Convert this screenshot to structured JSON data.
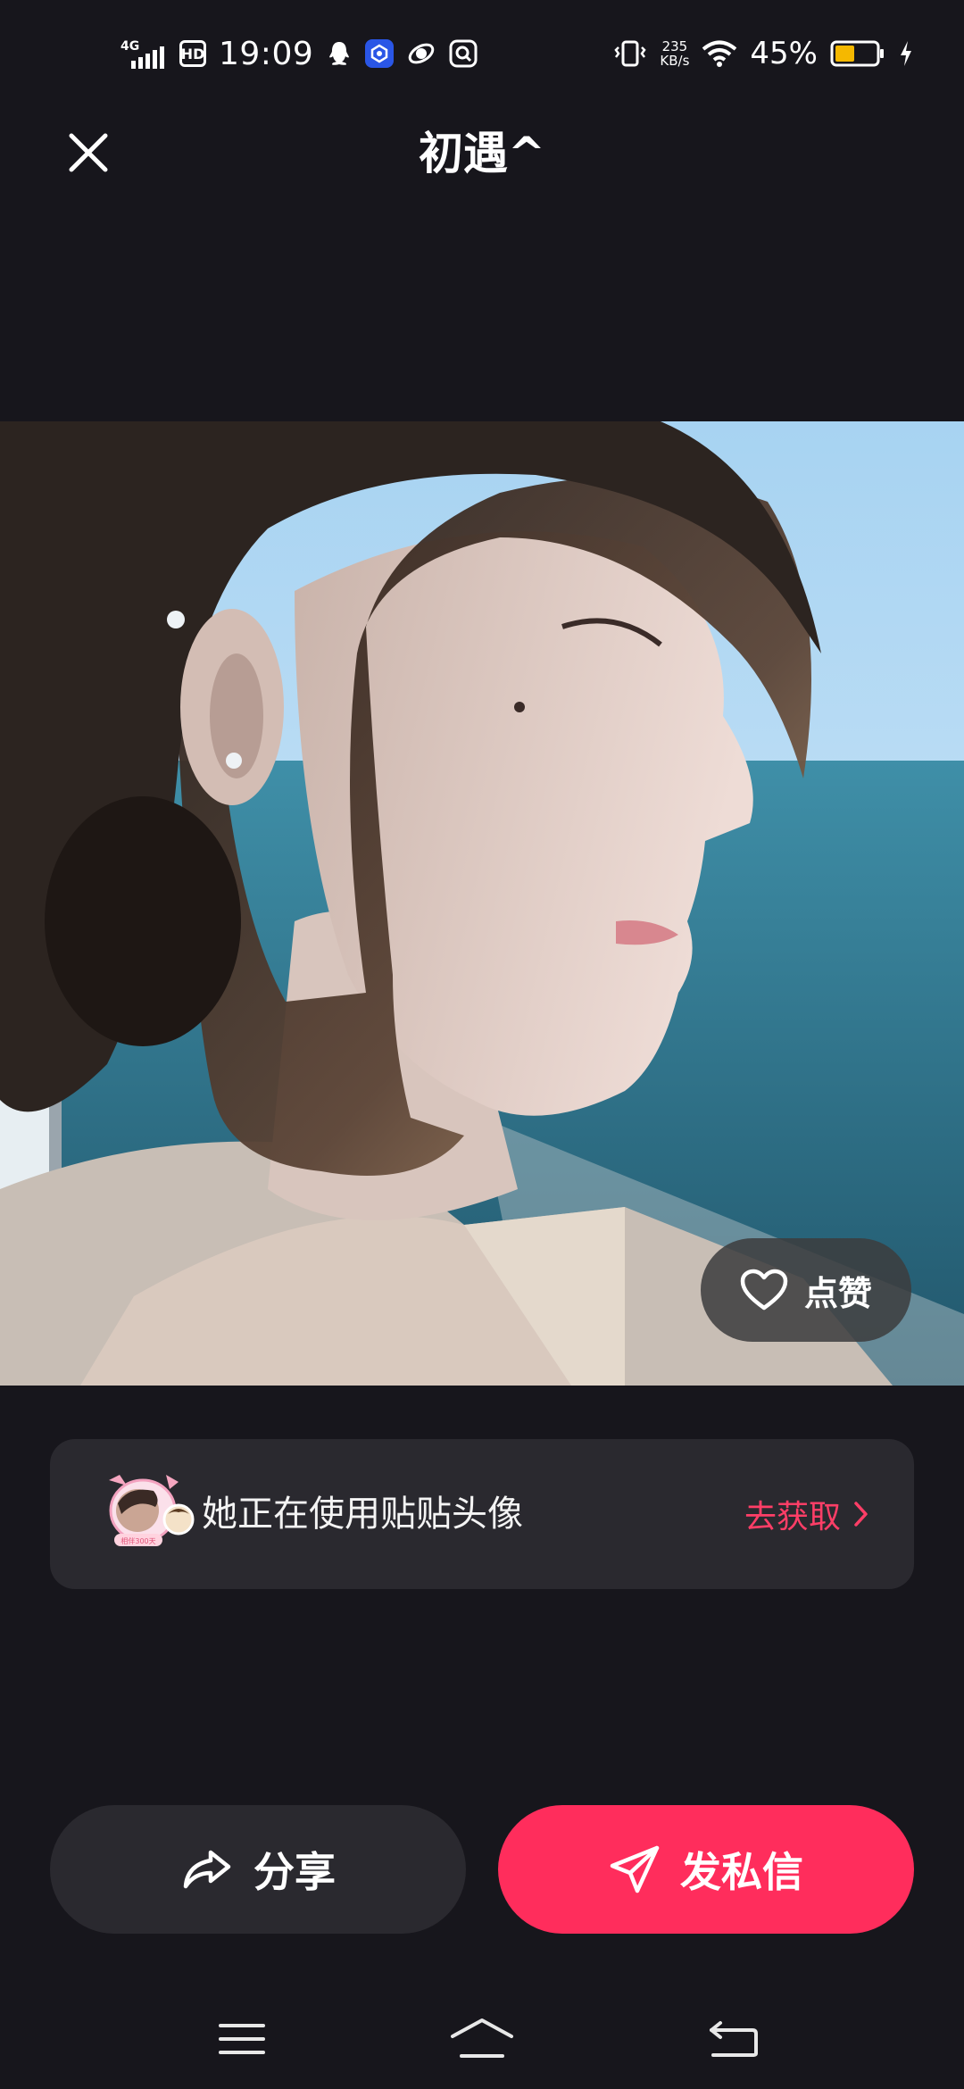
{
  "status_bar": {
    "network": "4G",
    "hd_label": "HD",
    "time": "19:09",
    "speed_value": "235",
    "speed_unit": "KB/s",
    "battery_pct": "45%",
    "battery_level": 0.45,
    "battery_color": "#f5b800"
  },
  "header": {
    "title": "初遇^",
    "close_icon": "close-icon"
  },
  "photo": {
    "description_icon": "profile-photo"
  },
  "like": {
    "label": "点赞",
    "icon": "heart-icon"
  },
  "promo": {
    "text": "她正在使用贴贴头像",
    "badge_text": "相伴300天",
    "cta": "去获取",
    "accent": "#ff3e67"
  },
  "actions": {
    "share_label": "分享",
    "message_label": "发私信",
    "message_color": "#ff2d5c"
  },
  "nav": {
    "menu_icon": "menu-icon",
    "home_icon": "home-icon",
    "back_icon": "back-icon"
  }
}
